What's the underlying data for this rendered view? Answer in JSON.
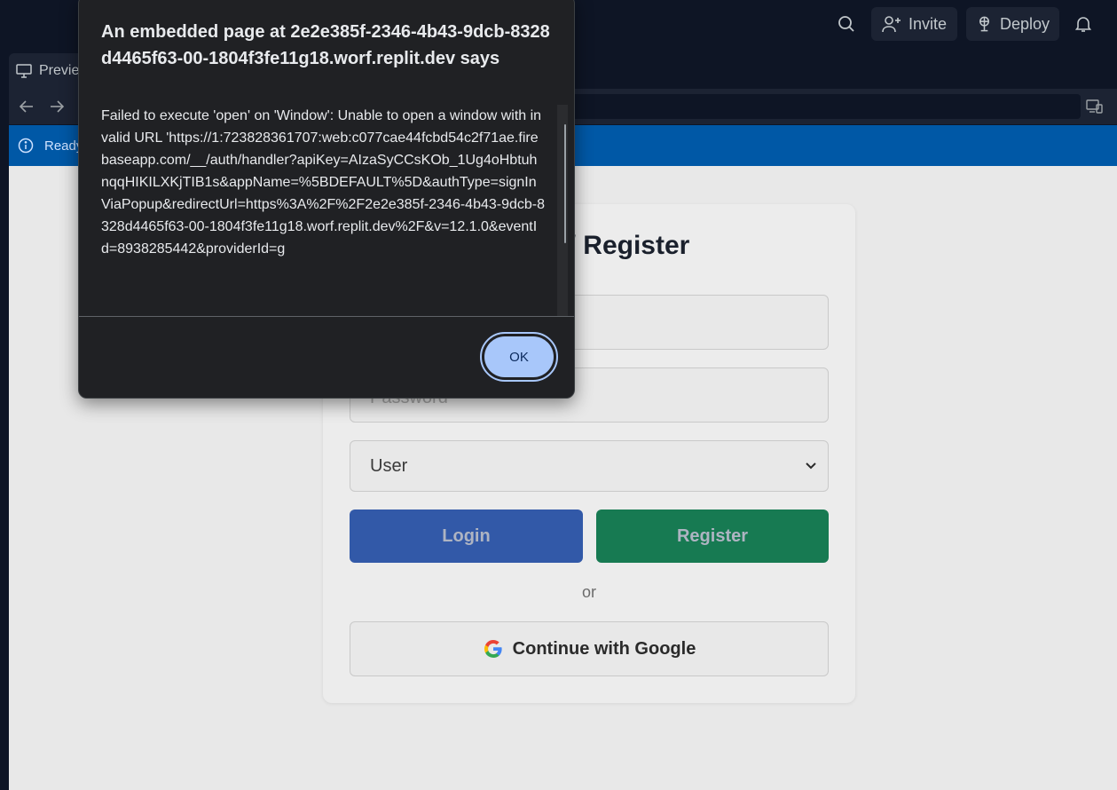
{
  "topbar": {
    "invite_label": "Invite",
    "deploy_label": "Deploy"
  },
  "tab": {
    "label": "Previe"
  },
  "banner": {
    "text": "Ready"
  },
  "login_card": {
    "title": "Login / Register",
    "password_placeholder": "Password",
    "role_select": "User",
    "login_label": "Login",
    "register_label": "Register",
    "divider": "or",
    "google_label": "Continue with Google"
  },
  "dialog": {
    "title": "An embedded page at 2e2e385f-2346-4b43-9dcb-8328d4465f63-00-1804f3fe11g18.worf.replit.dev says",
    "message": "Failed to execute 'open' on 'Window': Unable to open a window with invalid URL 'https://1:723828361707:web:c077cae44fcbd54c2f71ae.firebaseapp.com/__/auth/handler?apiKey=AIzaSyCCsKOb_1Ug4oHbtuhnqqHIKILXKjTIB1s&appName=%5BDEFAULT%5D&authType=signInViaPopup&redirectUrl=https%3A%2F%2F2e2e385f-2346-4b43-9dcb-8328d4465f63-00-1804f3fe11g18.worf.replit.dev%2F&v=12.1.0&eventId=8938285442&providerId=g",
    "ok_label": "OK"
  },
  "colors": {
    "accent": "#a8c7fa",
    "banner": "#0058a6",
    "login": "#3259a8",
    "register": "#177a52"
  }
}
